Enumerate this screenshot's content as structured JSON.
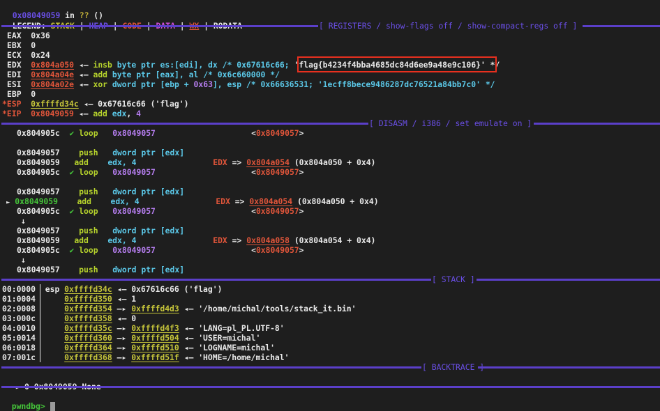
{
  "header": {
    "location_addr": "0x08049059",
    "location_in": " in ",
    "location_func": "??",
    "location_args": " ()"
  },
  "legend": {
    "label": "LEGEND: ",
    "items": [
      {
        "text": "STACK",
        "color": "#c7c13a"
      },
      {
        "text": "HEAP",
        "color": "#6a4fe6"
      },
      {
        "text": "CODE",
        "color": "#e0553a"
      },
      {
        "text": "DATA",
        "color": "#d04fd9"
      },
      {
        "text": "WX",
        "color": "#e0553a"
      },
      {
        "text": "RODATA",
        "color": "#e8e8e8"
      }
    ],
    "separator": " | "
  },
  "sections": {
    "registers": "[ REGISTERS / show-flags off / show-compact-regs off ]",
    "disasm": "[ DISASM / i386 / set emulate on ]",
    "stack": "[ STACK ]",
    "backtrace": "[ BACKTRACE ]"
  },
  "registers": {
    "eax": {
      "name": "EAX",
      "value": "0x36"
    },
    "ebx": {
      "name": "EBX",
      "value": "0"
    },
    "ecx": {
      "name": "ECX",
      "value": "0x24"
    },
    "edx": {
      "name": "EDX",
      "value": "0x804a050",
      "arrow": " ◂— ",
      "insn": "insb",
      "rest": " byte ptr es:[edi], dx /* 0x67616c66; ",
      "flag": "'flag{b4234f4bba4685dc84d6ee9a48e9c106}'",
      "tail": " */"
    },
    "edi": {
      "name": "EDI",
      "value": "0x804a04e",
      "arrow": " ◂— ",
      "insn": "add",
      "rest": " byte ptr [eax], al /* 0x6c660000 */"
    },
    "esi": {
      "name": "ESI",
      "value": "0x804a02e",
      "arrow": " ◂— ",
      "insn": "xor",
      "rest1": " dword ptr [ebp + ",
      "imm": "0x63",
      "rest2": "], esp /* 0x66636531; '1ecff8bece9486287dc76521a84bb7c0' */"
    },
    "ebp": {
      "name": "EBP",
      "value": "0"
    },
    "esp": {
      "name": "*ESP",
      "value": "0xffffd34c",
      "arrow": " ◂— ",
      "rest": "0x67616c66 ('flag')"
    },
    "eip": {
      "name": "*EIP",
      "value": "0x8049059",
      "arrow": " ◂— ",
      "insn": "add",
      "op1": " edx",
      "comma": ", ",
      "imm": "4"
    }
  },
  "disasm": {
    "rows": [
      {
        "addr": "0x804905c",
        "mark": "✔",
        "mnem": "loop",
        "ops": "0x8049057",
        "target": "0x8049057"
      },
      {
        "addr": "0x8049057",
        "mnem": "push",
        "ops": "dword ptr [edx]"
      },
      {
        "addr": "0x8049059",
        "mnem": "add",
        "ops": "edx, 4",
        "reg": "EDX",
        "arrow": " => ",
        "val": "0x804a054",
        "calc": " (0x804a050 + 0x4)"
      },
      {
        "addr": "0x804905c",
        "mark": "✔",
        "mnem": "loop",
        "ops": "0x8049057",
        "target": "0x8049057"
      },
      {
        "addr": "0x8049057",
        "mnem": "push",
        "ops": "dword ptr [edx]"
      },
      {
        "addr": "0x8049059",
        "current": true,
        "pointer": "►",
        "mnem": "add",
        "ops": "edx, 4",
        "reg": "EDX",
        "arrow": " => ",
        "val": "0x804a054",
        "calc": " (0x804a050 + 0x4)"
      },
      {
        "addr": "0x804905c",
        "mark": "✔",
        "mnem": "loop",
        "ops": "0x8049057",
        "target": "0x8049057"
      },
      {
        "down": "↓"
      },
      {
        "addr": "0x8049057",
        "mnem": "push",
        "ops": "dword ptr [edx]"
      },
      {
        "addr": "0x8049059",
        "mnem": "add",
        "ops": "edx, 4",
        "reg": "EDX",
        "arrow": " => ",
        "val": "0x804a058",
        "calc": " (0x804a054 + 0x4)"
      },
      {
        "addr": "0x804905c",
        "mark": "✔",
        "mnem": "loop",
        "ops": "0x8049057",
        "target": "0x8049057"
      },
      {
        "down": "↓"
      },
      {
        "addr": "0x8049057",
        "mnem": "push",
        "ops": "dword ptr [edx]"
      }
    ]
  },
  "stack": {
    "rows": [
      {
        "off": "00:0000",
        "reg": "esp",
        "addr": "0xffffd34c",
        "arrow": "◂—",
        "val": "0x67616c66 ('flag')"
      },
      {
        "off": "01:0004",
        "addr": "0xffffd350",
        "arrow": "◂—",
        "val": "1"
      },
      {
        "off": "02:0008",
        "addr": "0xffffd354",
        "arrow": "—▸",
        "ptr": "0xffffd4d3",
        "arrow2": "◂—",
        "val": "'/home/michal/tools/stack_it.bin'"
      },
      {
        "off": "03:000c",
        "addr": "0xffffd358",
        "arrow": "◂—",
        "val": "0"
      },
      {
        "off": "04:0010",
        "addr": "0xffffd35c",
        "arrow": "—▸",
        "ptr": "0xffffd4f3",
        "arrow2": "◂—",
        "val": "'LANG=pl_PL.UTF-8'"
      },
      {
        "off": "05:0014",
        "addr": "0xffffd360",
        "arrow": "—▸",
        "ptr": "0xffffd504",
        "arrow2": "◂—",
        "val": "'USER=michal'"
      },
      {
        "off": "06:0018",
        "addr": "0xffffd364",
        "arrow": "—▸",
        "ptr": "0xffffd510",
        "arrow2": "◂—",
        "val": "'LOGNAME=michal'"
      },
      {
        "off": "07:001c",
        "addr": "0xffffd368",
        "arrow": "—▸",
        "ptr": "0xffffd51f",
        "arrow2": "◂—",
        "val": "'HOME=/home/michal'"
      }
    ]
  },
  "backtrace": {
    "pointer": "►",
    "frame": "0",
    "addr": "0x8049059",
    "func": "None"
  },
  "prompt": {
    "label": "pwndbg>",
    "input": ""
  }
}
